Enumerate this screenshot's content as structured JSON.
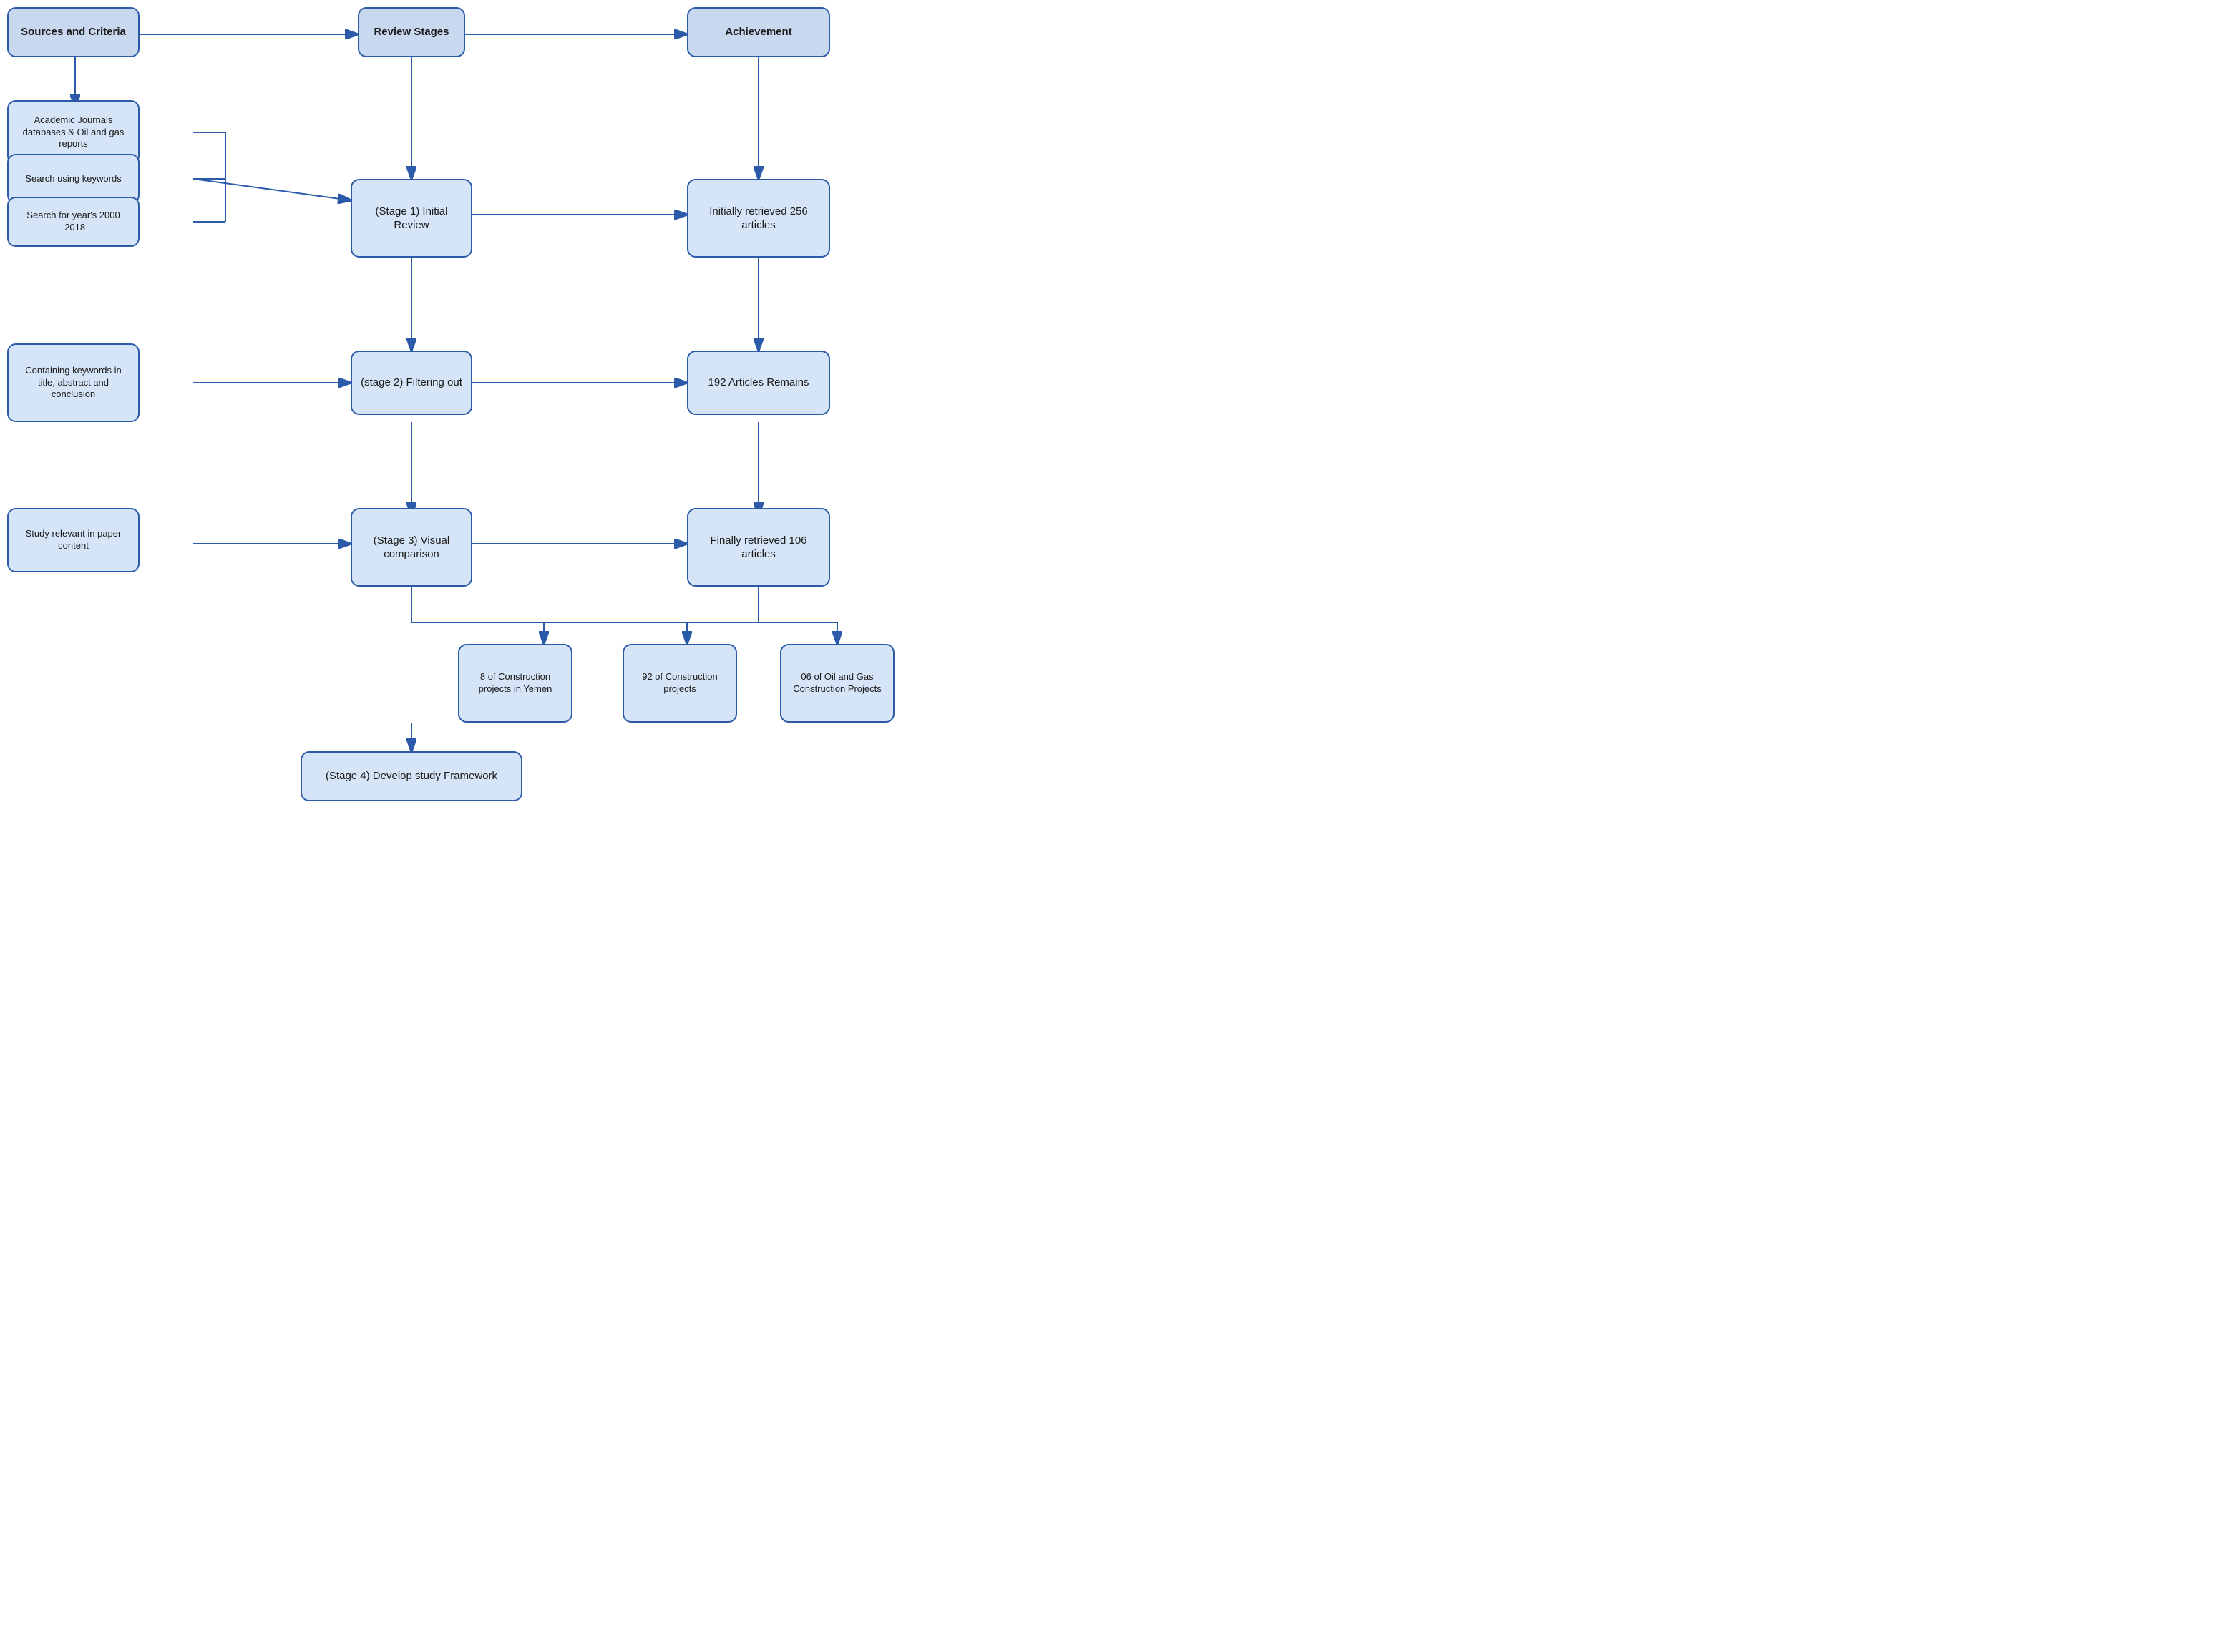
{
  "boxes": {
    "sources": "Sources and\nCriteria",
    "review_stages": "Review\nStages",
    "achievement": "Achievement",
    "academic": "Academic Journals\ndatabases & Oil\nand gas reports",
    "search_keywords": "Search using\nkeywords",
    "search_year": "Search for year's\n2000 -2018",
    "stage1": "(Stage 1)\nInitial Review",
    "initial_retrieved": "Initially retrieved\n256 articles",
    "containing": "Containing\nkeywords in title,\nabstract and\nconclusion",
    "stage2": "(stage 2)\nFiltering out",
    "articles_remains": "192 Articles\nRemains",
    "study_relevant": "Study relevant in\npaper content",
    "stage3": "(Stage 3)\nVisual\ncomparison",
    "finally_retrieved": "Finally retrieved\n106 articles",
    "construction_yemen": "8 of\nConstruction\nprojects in\nYemen",
    "construction_92": "92 of\nConstruction\nprojects",
    "oil_gas_06": "06 of\nOil and Gas\nConstruction\nProjects",
    "stage4": "(Stage 4)\nDevelop study Framework"
  }
}
